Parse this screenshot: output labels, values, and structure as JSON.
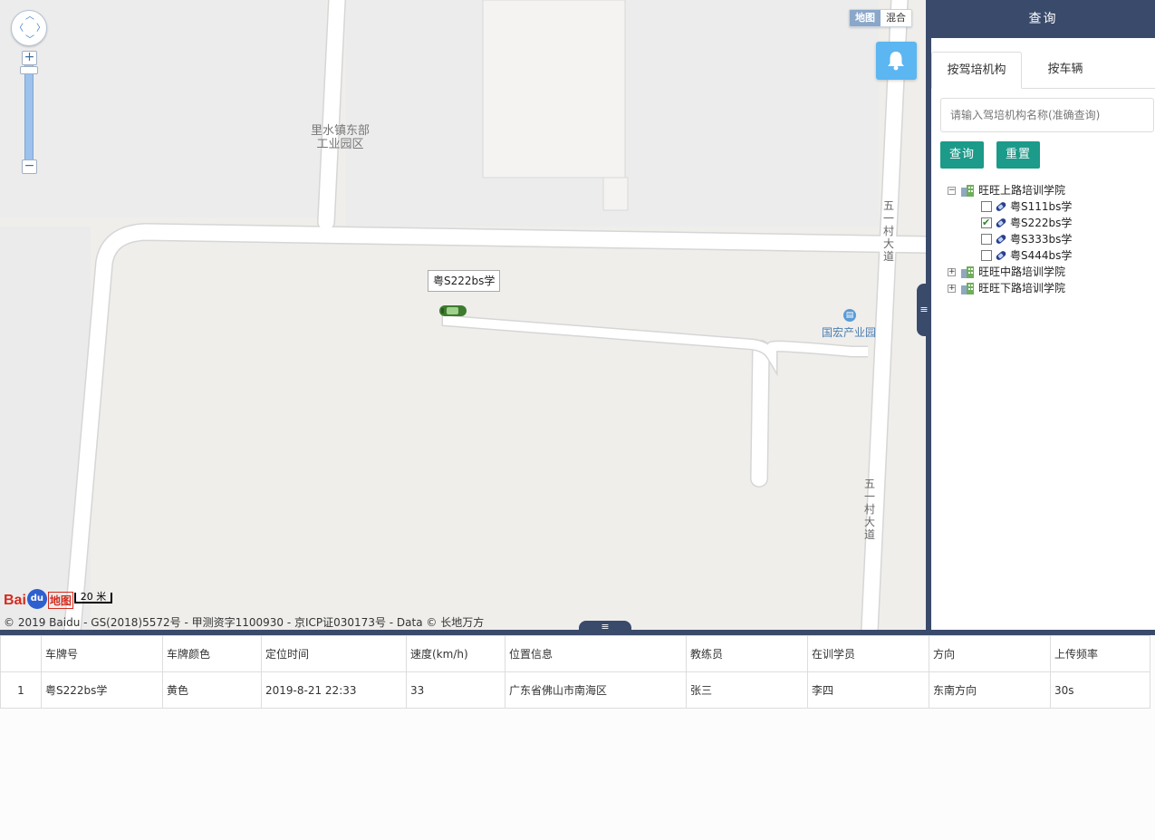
{
  "map": {
    "area_label_line1": "里水镇东部",
    "area_label_line2": "工业园区",
    "road_label_upper": "五一村大道",
    "road_label_lower": "五一村大道",
    "poi_label": "国宏产业园",
    "maptype_map": "地图",
    "maptype_hybrid": "混合",
    "vehicle_label": "粤S222bs学",
    "scale_text": "20 米",
    "logo_text_1": "Bai",
    "logo_text_paw": "du",
    "logo_text_2": "地图",
    "copyright": "© 2019 Baidu - GS(2018)5572号 - 甲测资字1100930 - 京ICP证030173号 - Data © 长地万方",
    "zoom_in": "+",
    "zoom_out": "−"
  },
  "panel": {
    "title": "查询",
    "tabs": [
      "按驾培机构",
      "按车辆"
    ],
    "search_placeholder": "请输入驾培机构名称(准确查询)",
    "query_button": "查询",
    "reset_button": "重置",
    "tree": [
      {
        "label": "旺旺上路培训学院",
        "expanded": true,
        "toggle": "⊟",
        "children": [
          {
            "label": "粤S111bs学",
            "checked": false
          },
          {
            "label": "粤S222bs学",
            "checked": true
          },
          {
            "label": "粤S333bs学",
            "checked": false
          },
          {
            "label": "粤S444bs学",
            "checked": false
          }
        ]
      },
      {
        "label": "旺旺中路培训学院",
        "expanded": false,
        "toggle": "⊞",
        "children": []
      },
      {
        "label": "旺旺下路培训学院",
        "expanded": false,
        "toggle": "⊞",
        "children": []
      }
    ]
  },
  "grid": {
    "columns": [
      "",
      "车牌号",
      "车牌颜色",
      "定位时间",
      "速度(km/h)",
      "位置信息",
      "教练员",
      "在训学员",
      "方向",
      "上传频率"
    ],
    "rows": [
      [
        "1",
        "粤S222bs学",
        "黄色",
        "2019-8-21 22:33",
        "33",
        "广东省佛山市南海区",
        "张三",
        "李四",
        "东南方向",
        "30s"
      ]
    ]
  },
  "colors": {
    "header_bg": "#3a4a6b",
    "button_bg": "#1c9a8a",
    "bell_bg": "#5bb6f2",
    "map_bg": "#f1f0ed"
  }
}
